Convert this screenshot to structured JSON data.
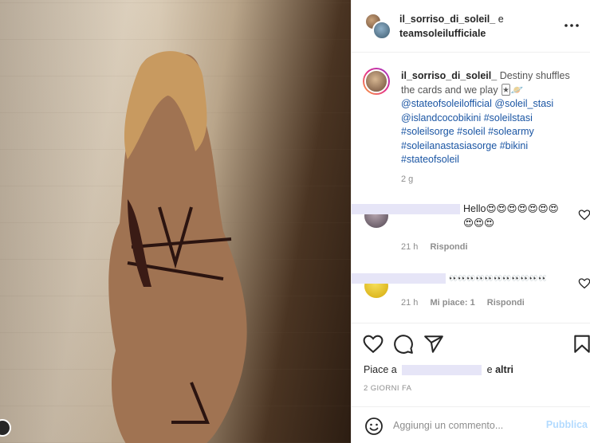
{
  "header": {
    "user1": "il_sorriso_di_soleil_",
    "joiner": "e",
    "user2": "teamsoleilufficiale",
    "more_icon": "more-horizontal-icon"
  },
  "caption": {
    "username": "il_sorriso_di_soleil_",
    "text": "Destiny shuffles the cards and we play 🃏🪐",
    "tags": "@stateofsoleilofficial @soleil_stasi @islandcocobikini #soleilstasi #soleilsorge #soleil #solearmy #soleilanastasiasorge #bikini #stateofsoleil",
    "time": "2 g"
  },
  "comments": [
    {
      "text": "Hello😍😍😍😍😍😍😍😍😍😍",
      "time": "21 h",
      "reply": "Rispondi"
    },
    {
      "text": "👀👀👀👀👀👀👀👀👀👀👀👀👀👀👀👀👀👀👀👀👀👀👀👀👀👀👀👀👀👀",
      "time": "21 h",
      "likes": "Mi piace: 1",
      "reply": "Rispondi"
    }
  ],
  "actions": {
    "likes_prefix": "Piace a",
    "likes_suffix": "e",
    "likes_others": "altri",
    "date": "2 GIORNI FA"
  },
  "add_comment": {
    "placeholder": "Aggiungi un commento...",
    "publish": "Pubblica"
  },
  "colors": {
    "link": "#1a55a3",
    "publish_disabled": "#b3dbff",
    "muted": "#8e8e8e"
  }
}
